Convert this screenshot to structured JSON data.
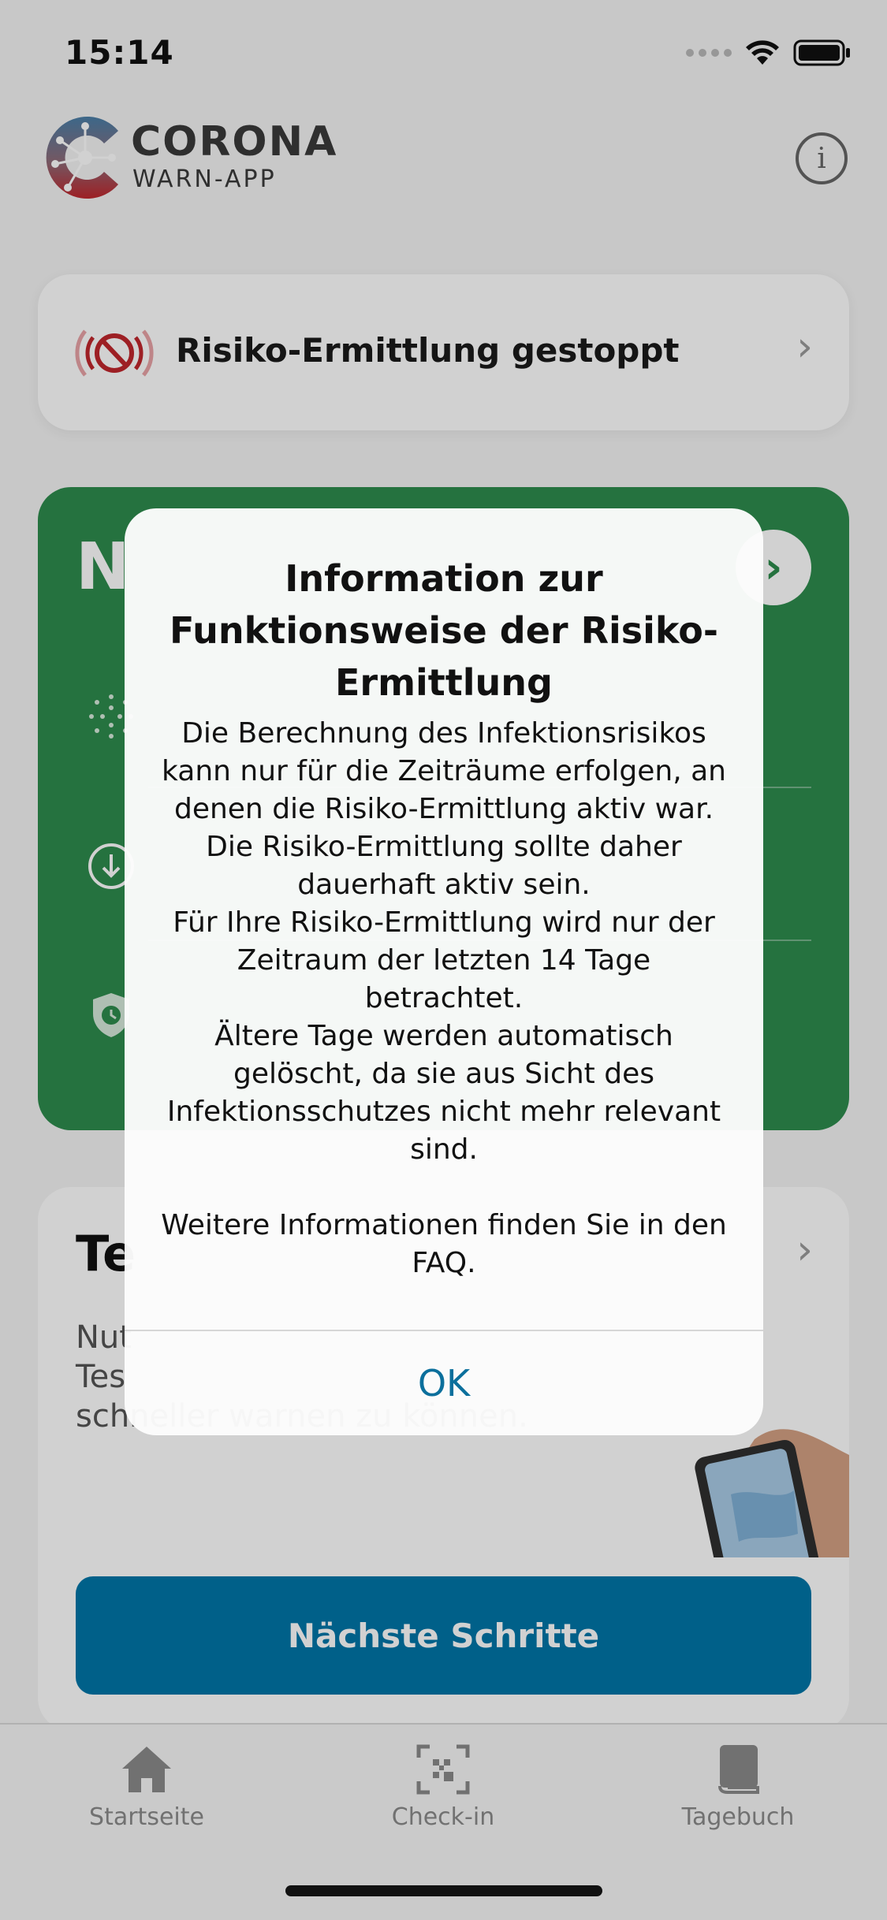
{
  "status_bar": {
    "time": "15:14",
    "icons": [
      "signal-dots-icon",
      "wifi-icon",
      "battery-icon"
    ]
  },
  "header": {
    "logo_title": "CORONA",
    "logo_subtitle": "WARN-APP",
    "info_icon": "info-circle-icon"
  },
  "risk_status_card": {
    "label": "Risiko-Ermittlung gestoppt",
    "icon": "risk-stopped-icon"
  },
  "risk_card": {
    "title_visible": "N",
    "color": "#2e8b4d"
  },
  "test_card": {
    "title_visible": "Te",
    "body_visible": "Nut\nTes\nschneller warnen zu können.",
    "button_label": "Nächste Schritte"
  },
  "tab_bar": {
    "tabs": [
      {
        "label": "Startseite",
        "icon": "home-icon"
      },
      {
        "label": "Check-in",
        "icon": "qr-code-icon"
      },
      {
        "label": "Tagebuch",
        "icon": "book-icon"
      }
    ]
  },
  "alert": {
    "title": "Information zur Funktionsweise der Risiko-Ermittlung",
    "message": "Die Berechnung des Infektionsrisikos kann nur für die Zeiträume erfolgen, an denen die Risiko-Ermittlung aktiv war. Die Risiko-Ermittlung sollte daher dauerhaft aktiv sein.\nFür Ihre Risiko-Ermittlung wird nur der Zeitraum der letzten 14 Tage betrachtet.\nÄltere Tage werden automatisch gelöscht, da sie aus Sicht des Infektionsschutzes nicht mehr relevant sind.\n\nWeitere Informationen finden Sie in den FAQ.",
    "ok_label": "OK"
  },
  "colors": {
    "primary_button": "#0076a8",
    "alert_action": "#0b6f9c",
    "risk_low": "#2e8b4d",
    "stopped_red": "#c0272d"
  }
}
